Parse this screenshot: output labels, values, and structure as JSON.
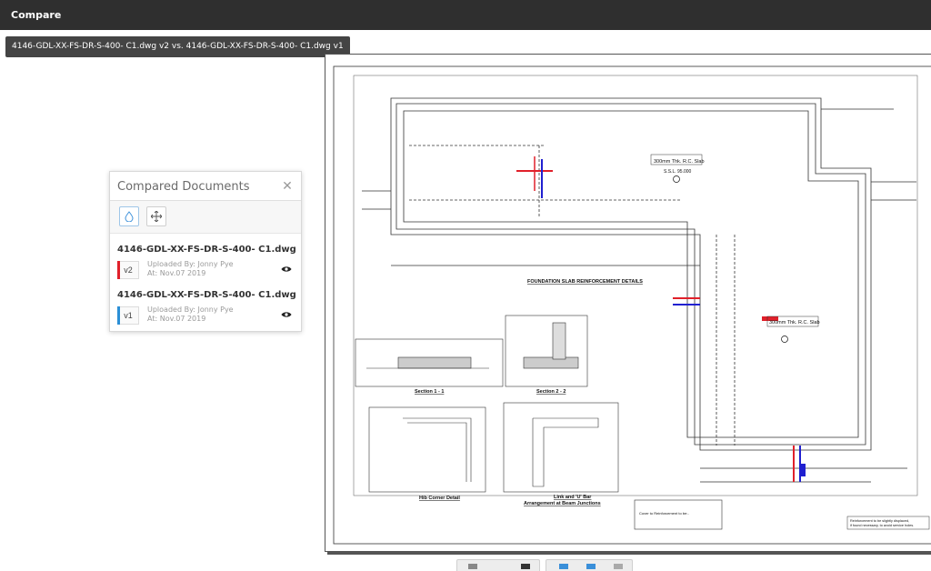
{
  "app": {
    "title": "Compare"
  },
  "comparison_label": "4146-GDL-XX-FS-DR-S-400- C1.dwg v2 vs. 4146-GDL-XX-FS-DR-S-400- C1.dwg v1",
  "panel": {
    "title": "Compared Documents",
    "close_icon": "close-icon",
    "tools": [
      "drop-icon",
      "move-icon"
    ],
    "documents": [
      {
        "name": "4146-GDL-XX-FS-DR-S-400- C1.dwg",
        "version": "v2",
        "uploaded_by": "Uploaded By: Jonny Pye",
        "at": "At: Nov.07 2019",
        "color": "#e0202a"
      },
      {
        "name": "4146-GDL-XX-FS-DR-S-400- C1.dwg",
        "version": "v1",
        "uploaded_by": "Uploaded By: Jonny Pye",
        "at": "At: Nov.07 2019",
        "color": "#2b8fd6"
      }
    ]
  },
  "drawing": {
    "main_title": "FOUNDATION SLAB REINFORCEMENT DETAILS",
    "slab_label_1": "300mm Thk. R.C. Slab",
    "ssl_1": "S.S.L. 95.000",
    "slab_label_2": "300mm Thk. R.C. Slab",
    "section_1": "Section 1 - 1",
    "section_2": "Section 2 - 2",
    "detail_1": "Hib Corner Detail",
    "detail_2": "Link and 'U' Bar",
    "detail_2b": "Arrangement at Beam Junctions",
    "note_1": "Cover to Reinforcement to be:-",
    "note_2": "Reinforcement to be slightly displaced,",
    "note_3": "if found necessary, to avoid service holes.",
    "colors": {
      "v2": "#e0202a",
      "v1": "#2020d0",
      "line": "#333333"
    }
  }
}
